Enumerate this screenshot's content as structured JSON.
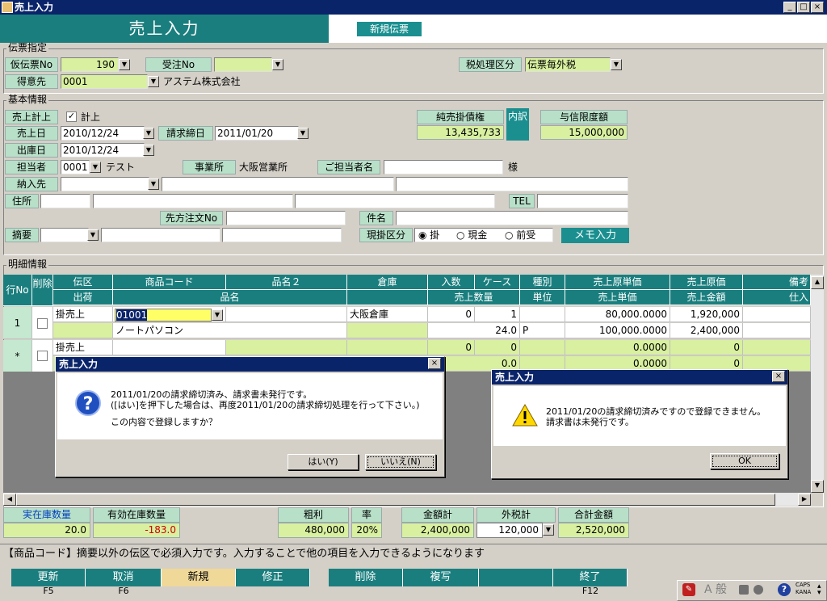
{
  "window": {
    "title": "売上入力"
  },
  "header": {
    "title": "売上入力",
    "new_slip_button": "新規伝票"
  },
  "slip_section": {
    "label": "伝票指定",
    "temp_slip_no_label": "仮伝票No",
    "temp_slip_no": "190",
    "order_no_label": "受注No",
    "order_no": "",
    "tax_label": "税処理区分",
    "tax_value": "伝票毎外税",
    "customer_label": "得意先",
    "customer_code": "0001",
    "customer_name": "アステム株式会社"
  },
  "basic_section": {
    "label": "基本情報",
    "sales_record_label": "売上計上",
    "sales_record_check": "計上",
    "sales_date_label": "売上日",
    "sales_date": "2010/12/24",
    "billing_close_label": "請求締日",
    "billing_close": "2011/01/20",
    "ship_date_label": "出庫日",
    "ship_date": "2010/12/24",
    "staff_label": "担当者",
    "staff_code": "0001",
    "staff_name": "テスト",
    "office_label": "事業所",
    "office_value": "大阪営業所",
    "contact_label": "ご担当者名",
    "contact_suffix": "様",
    "delivery_label": "納入先",
    "address_label": "住所",
    "tel_label": "TEL",
    "client_order_label": "先方注文No",
    "subject_label": "件名",
    "memo_label": "摘要",
    "payment_label": "現掛区分",
    "payment_options": [
      "掛",
      "現金",
      "前受"
    ],
    "memo_button": "メモ入力",
    "receivable_label": "純売掛債権",
    "receivable_value": "13,435,733",
    "breakdown_button": "内訳",
    "credit_limit_label": "与信限度額",
    "credit_limit_value": "15,000,000"
  },
  "detail_section": {
    "label": "明細情報",
    "headers_top": [
      "行No",
      "削除",
      "伝区",
      "商品コード",
      "品名２",
      "倉庫",
      "入数",
      "ケース",
      "種別",
      "売上原単価",
      "売上原価",
      "備考"
    ],
    "headers_bottom": [
      "出荷",
      "品名",
      "売上数量",
      "単位",
      "売上単価",
      "売上金額",
      "仕入"
    ],
    "row1": {
      "no": "1",
      "type": "掛売上",
      "code": "01001",
      "warehouse": "大阪倉庫",
      "qty_per": "0",
      "cases": "1",
      "cost_unit": "80,000.0000",
      "cost": "1,920,000",
      "name": "ノートパソコン",
      "sales_qty": "24.0",
      "unit": "P",
      "sale_unit": "100,000.0000",
      "sale_amount": "2,400,000"
    },
    "row_new": {
      "no": "*",
      "type": "掛売上",
      "qty_per": "0",
      "cases": "0",
      "cost_unit": "0.0000",
      "cost": "0",
      "sales_qty": "0.0",
      "sale_unit": "0.0000",
      "sale_amount": "0"
    }
  },
  "dialog1": {
    "title": "売上入力",
    "line1": "2011/01/20の請求締切済み、請求書未発行です。",
    "line2": "([はい]を押下した場合は、再度2011/01/20の請求締切処理を行って下さい。)",
    "line3": "この内容で登録しますか？",
    "yes_button": "はい(Y)",
    "no_button": "いいえ(N)"
  },
  "dialog2": {
    "title": "売上入力",
    "line1": "2011/01/20の請求締切済みですので登録できません。",
    "line2": "請求書は未発行です。",
    "ok_button": "OK"
  },
  "summary": {
    "actual_stock_label": "実在庫数量",
    "actual_stock": "20.0",
    "effective_stock_label": "有効在庫数量",
    "effective_stock": "-183.0",
    "gross_profit_label": "粗利",
    "gross_profit": "480,000",
    "rate_label": "率",
    "rate": "20%",
    "amount_total_label": "金額計",
    "amount_total": "2,400,000",
    "tax_total_label": "外税計",
    "tax_total": "120,000",
    "grand_total_label": "合計金額",
    "grand_total": "2,520,000"
  },
  "status": {
    "message": "【商品コード】摘要以外の伝区で必須入力です。入力することで他の項目を入力できるようになります"
  },
  "function_keys": [
    {
      "label": "更新",
      "key": "F5"
    },
    {
      "label": "取消",
      "key": "F6"
    },
    {
      "label": "新規",
      "key": ""
    },
    {
      "label": "修正",
      "key": ""
    },
    {
      "label": "削除",
      "key": ""
    },
    {
      "label": "複写",
      "key": ""
    },
    {
      "label": "",
      "key": ""
    },
    {
      "label": "終了",
      "key": "F12"
    }
  ],
  "ime": {
    "mode": "A 般",
    "caps": "CAPS",
    "kana": "KANA"
  },
  "colors": {
    "teal": "#1b7e7e",
    "title_bar": "#0a246a",
    "label_green": "#b8e0c8",
    "value_green": "#d8f0a0",
    "yellow": "#ffff99"
  }
}
